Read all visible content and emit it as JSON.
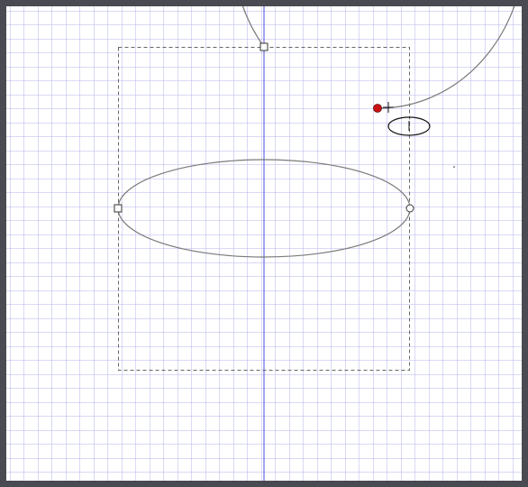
{
  "app": {
    "view": "drawing-canvas"
  },
  "colors": {
    "frame": "#4a4a52",
    "canvas_background": "#ffffff",
    "grid_line": "#b3b3ee",
    "axis_line": "#6a6ae6",
    "shape_stroke": "#7a7a7a",
    "selection_box": "#666666",
    "handle_fill": "#ffffff",
    "handle_stroke": "#333333",
    "active_point": "#cc1111",
    "cursor": "#111111"
  },
  "icons": {
    "drawing_cursor": "crosshair-plus-icon",
    "ellipse_tool_hint": "ellipse-tool-icon"
  },
  "shape": {
    "kind": "sphere-wireframe",
    "parts": [
      "outer-arc",
      "equator-ellipse",
      "vertical-axis"
    ]
  }
}
